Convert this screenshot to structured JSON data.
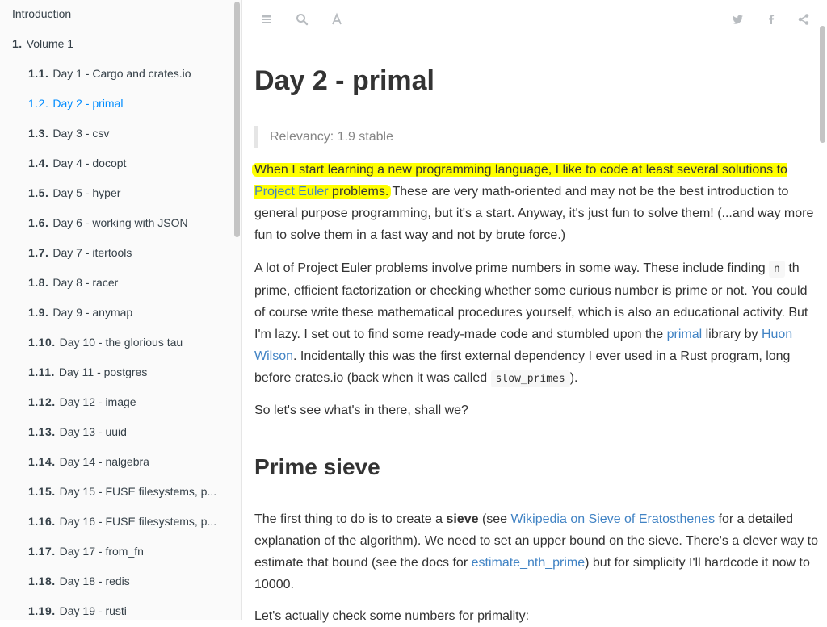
{
  "sidebar": {
    "intro": "Introduction",
    "volume": {
      "num": "1.",
      "label": "Volume 1"
    },
    "items": [
      {
        "num": "1.1.",
        "label": "Day 1 - Cargo and crates.io"
      },
      {
        "num": "1.2.",
        "label": "Day 2 - primal"
      },
      {
        "num": "1.3.",
        "label": "Day 3 - csv"
      },
      {
        "num": "1.4.",
        "label": "Day 4 - docopt"
      },
      {
        "num": "1.5.",
        "label": "Day 5 - hyper"
      },
      {
        "num": "1.6.",
        "label": "Day 6 - working with JSON"
      },
      {
        "num": "1.7.",
        "label": "Day 7 - itertools"
      },
      {
        "num": "1.8.",
        "label": "Day 8 - racer"
      },
      {
        "num": "1.9.",
        "label": "Day 9 - anymap"
      },
      {
        "num": "1.10.",
        "label": "Day 10 - the glorious tau"
      },
      {
        "num": "1.11.",
        "label": "Day 11 - postgres"
      },
      {
        "num": "1.12.",
        "label": "Day 12 - image"
      },
      {
        "num": "1.13.",
        "label": "Day 13 - uuid"
      },
      {
        "num": "1.14.",
        "label": "Day 14 - nalgebra"
      },
      {
        "num": "1.15.",
        "label": "Day 15 - FUSE filesystems, p..."
      },
      {
        "num": "1.16.",
        "label": "Day 16 - FUSE filesystems, p..."
      },
      {
        "num": "1.17.",
        "label": "Day 17 - from_fn"
      },
      {
        "num": "1.18.",
        "label": "Day 18 - redis"
      },
      {
        "num": "1.19.",
        "label": "Day 19 - rusti"
      }
    ],
    "active_index": 1
  },
  "header": {
    "left_icons": [
      "menu-icon",
      "search-icon",
      "font-settings-icon"
    ],
    "right_icons": [
      "twitter-icon",
      "facebook-icon",
      "share-icon"
    ]
  },
  "content": {
    "title": "Day 2 - primal",
    "relevancy": "Relevancy: 1.9 stable",
    "p1": {
      "highlight_before": "When I start learning a new programming language, I like to code at least several solutions to ",
      "highlight_link": "Project Euler",
      "highlight_after": " problems.",
      "rest": " These are very math-oriented and may not be the best introduction to general purpose programming, but it's a start. Anyway, it's just fun to solve them! (...and way more fun to solve them in a fast way and not by brute force.)"
    },
    "p2": {
      "t1": "A lot of Project Euler problems involve prime numbers in some way. These include finding ",
      "code1": "n",
      "t2": " th prime, efficient factorization or checking whether some curious number is prime or not. You could of course write these mathematical procedures yourself, which is also an educational activity. But I'm lazy. I set out to find some ready-made code and stumbled upon the ",
      "link1": "primal",
      "t3": " library by ",
      "link2": "Huon Wilson",
      "t4": ". Incidentally this was the first external dependency I ever used in a Rust program, long before crates.io (back when it was called ",
      "code2": "slow_primes",
      "t5": ")."
    },
    "p3": "So let's see what's in there, shall we?",
    "section_title": "Prime sieve",
    "p4": {
      "t1": "The first thing to do is to create a ",
      "bold": "sieve",
      "t2": " (see ",
      "link1": "Wikipedia on Sieve of Eratosthenes",
      "t3": " for a detailed explanation of the algorithm). We need to set an upper bound on the sieve. There's a clever way to estimate that bound (see the docs for ",
      "link2": "estimate_nth_prime",
      "t4": ") but for simplicity I'll hardcode it now to 10000."
    },
    "p5": "Let's actually check some numbers for primality:"
  }
}
